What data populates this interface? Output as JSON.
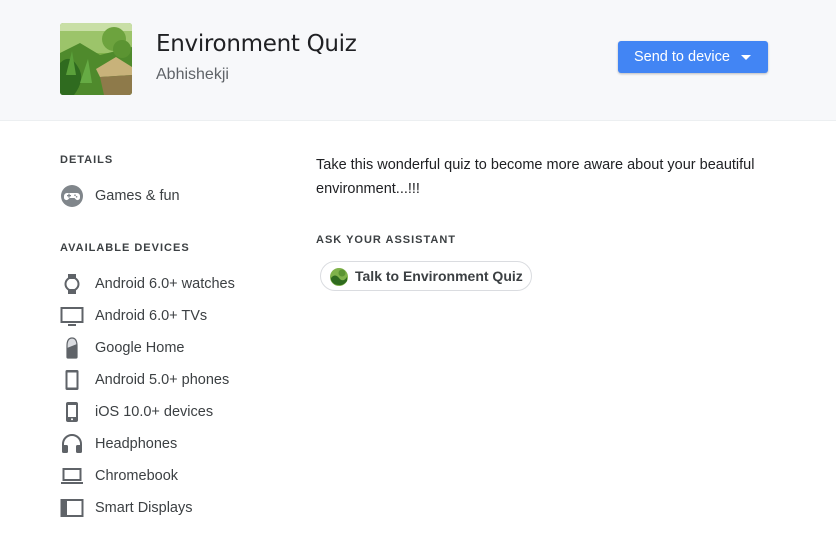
{
  "app": {
    "title": "Environment Quiz",
    "author": "Abhishekji",
    "logo_icon": "jungle-hut-photo"
  },
  "actions": {
    "send_label": "Send to device",
    "send_icon": "caret-down-icon"
  },
  "details": {
    "heading": "DETAILS",
    "category": {
      "label": "Games & fun",
      "icon": "gamepad-icon"
    }
  },
  "devices": {
    "heading": "AVAILABLE DEVICES",
    "items": [
      {
        "label": "Android 6.0+ watches",
        "icon": "watch-icon"
      },
      {
        "label": "Android 6.0+ TVs",
        "icon": "tv-icon"
      },
      {
        "label": "Google Home",
        "icon": "google-home-icon"
      },
      {
        "label": "Android 5.0+ phones",
        "icon": "android-phone-icon"
      },
      {
        "label": "iOS 10.0+ devices",
        "icon": "iphone-icon"
      },
      {
        "label": "Headphones",
        "icon": "headphones-icon"
      },
      {
        "label": "Chromebook",
        "icon": "laptop-icon"
      },
      {
        "label": "Smart Displays",
        "icon": "smart-display-icon"
      }
    ]
  },
  "description": "Take this wonderful quiz to become more aware about your beautiful environment...!!!",
  "assistant": {
    "heading": "ASK YOUR ASSISTANT",
    "chip_label": "Talk to Environment Quiz",
    "chip_icon": "app-logo-icon"
  },
  "colors": {
    "accent": "#4285f4",
    "header_bg": "#f7f8fa",
    "icon_gray": "#5f6368"
  }
}
